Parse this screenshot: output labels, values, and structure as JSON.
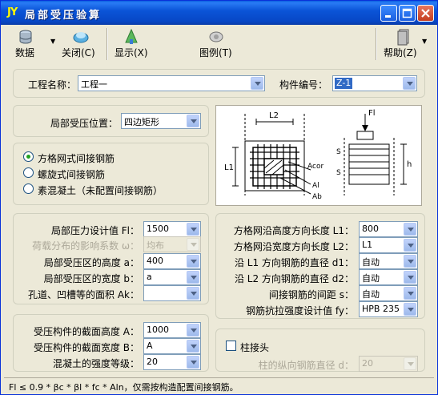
{
  "window": {
    "logo": "JY",
    "title": "局部受压验算"
  },
  "toolbar": {
    "data_label": "数据",
    "close_label": "关闭(C)",
    "display_label": "显示(X)",
    "legend_label": "图例(T)",
    "help_label": "帮助(Z)"
  },
  "project": {
    "name_label": "工程名称：",
    "name_value": "工程一",
    "component_label": "构件编号：",
    "component_value": "Z-1"
  },
  "position": {
    "label": "局部受压位置：",
    "value": "四边矩形"
  },
  "reinforcement_type": {
    "options": [
      "方格网式间接钢筋",
      "螺旋式间接钢筋",
      "素混凝土（未配置间接钢筋）"
    ],
    "selected": 0
  },
  "diagram": {
    "labels": {
      "l2": "L2",
      "l1": "L1",
      "fl": "Fl",
      "acor": "Acor",
      "al": "Al",
      "ab": "Ab",
      "s1": "S",
      "s2": "S",
      "h": "h"
    }
  },
  "load": {
    "fl_label": "局部压力设计值 Fl：",
    "fl_value": "1500",
    "omega_label": "荷载分布的影响系数 ω：",
    "omega_value": "均布",
    "a_label": "局部受压区的高度 a：",
    "a_value": "400",
    "b_label": "局部受压区的宽度 b：",
    "b_value": "a",
    "ak_label": "孔道、凹槽等的面积 Ak：",
    "ak_value": ""
  },
  "mesh": {
    "l1_label": "方格网沿高度方向长度 L1：",
    "l1_value": "800",
    "l2_label": "方格网沿宽度方向长度 L2：",
    "l2_value": "L1",
    "d1_label": "沿 L1 方向钢筋的直径 d1：",
    "d1_value": "自动",
    "d2_label": "沿 L2 方向钢筋的直径 d2：",
    "d2_value": "自动",
    "s_label": "间接钢筋的间距 s：",
    "s_value": "自动",
    "fy_label": "钢筋抗拉强度设计值 fy：",
    "fy_value": "HPB 235"
  },
  "section": {
    "h_label": "受压构件的截面高度 A：",
    "h_value": "1000",
    "b_label": "受压构件的截面宽度 B：",
    "b_value": "A",
    "grade_label": "混凝土的强度等级：",
    "grade_value": "20"
  },
  "column_joint": {
    "checkbox_label": "柱接头",
    "rebar_label": "柱的纵向钢筋直径 d：",
    "rebar_value": "20"
  },
  "status_text": "Fl ≤ 0.9 * βc * βl * fc * Aln，仅需按构造配置间接钢筋。",
  "colors": {
    "titlebar": "#0747C6",
    "face": "#ECE9D8",
    "selection": "#316AC5"
  }
}
